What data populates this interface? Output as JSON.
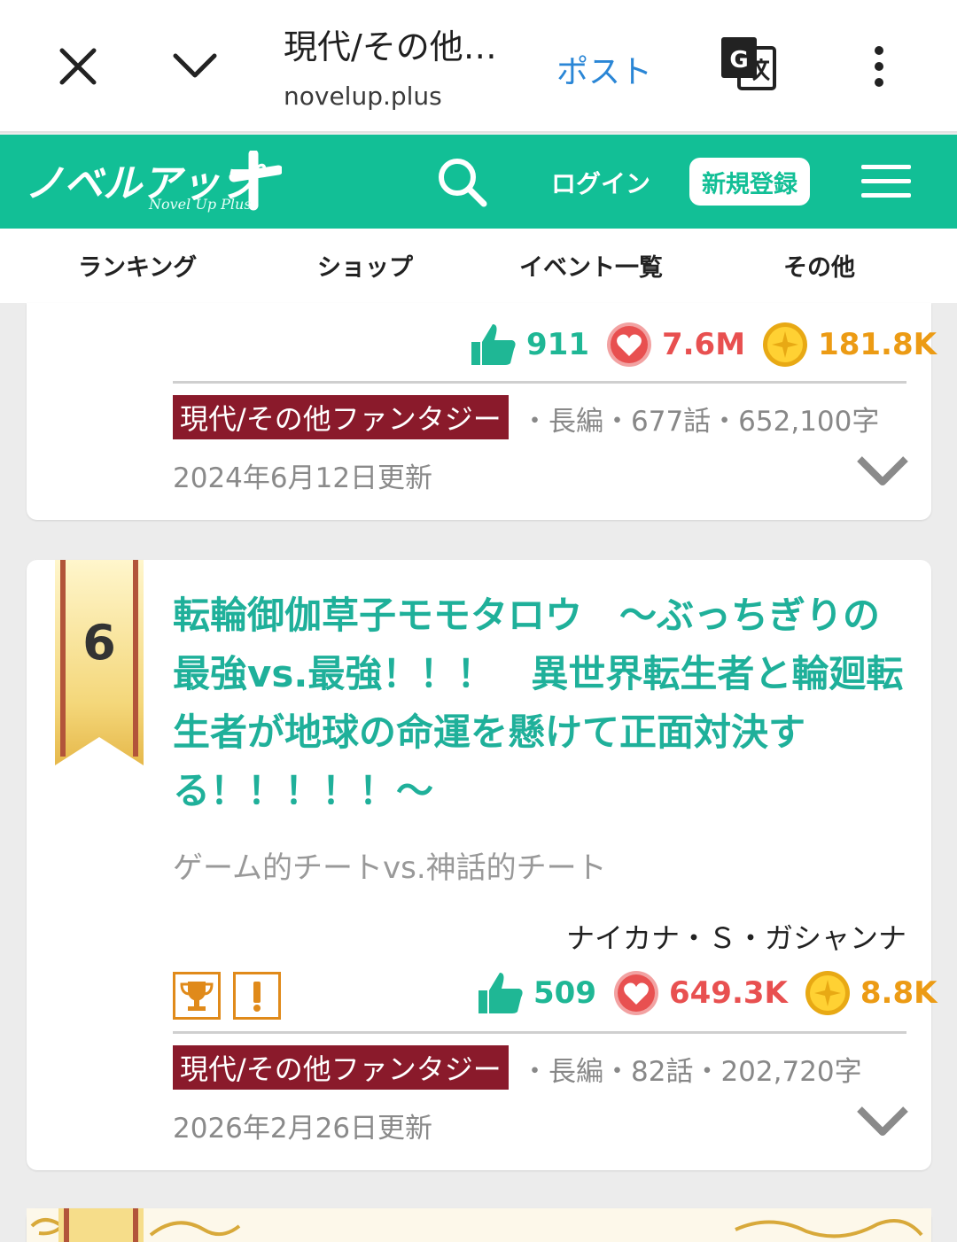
{
  "browser": {
    "title": "現代/その他…",
    "domain": "novelup.plus",
    "post_label": "ポスト"
  },
  "header": {
    "logo_text": "ノベルアップ+",
    "logo_sub": "Novel Up Plus",
    "login_label": "ログイン",
    "register_label": "新規登録"
  },
  "nav": {
    "items": [
      {
        "label": "ランキング"
      },
      {
        "label": "ショップ"
      },
      {
        "label": "イベント一覧"
      },
      {
        "label": "その他"
      }
    ]
  },
  "entries": [
    {
      "likes": "911",
      "hearts": "7.6M",
      "coins": "181.8K",
      "genre": "現代/その他ファンタジー",
      "meta": "・長編・677話・652,100字",
      "updated": "2024年6月12日更新"
    },
    {
      "rank": "6",
      "title": "転輪御伽草子モモタロウ　～ぶっちぎりの最強vs.最強！！！　異世界転生者と輪廻転生者が地球の命運を懸けて正面対決する！！！！！～",
      "catchphrase": "ゲーム的チートvs.神話的チート",
      "author": "ナイカナ・Ｓ・ガシャンナ",
      "likes": "509",
      "hearts": "649.3K",
      "coins": "8.8K",
      "genre": "現代/その他ファンタジー",
      "meta": "・長編・82話・202,720字",
      "updated": "2026年2月26日更新"
    }
  ],
  "colors": {
    "brand": "#12bf96",
    "title_text": "#1fb09a",
    "genre_bg": "#8a1a2b",
    "heart": "#e85050",
    "coin": "#ec9b14"
  }
}
